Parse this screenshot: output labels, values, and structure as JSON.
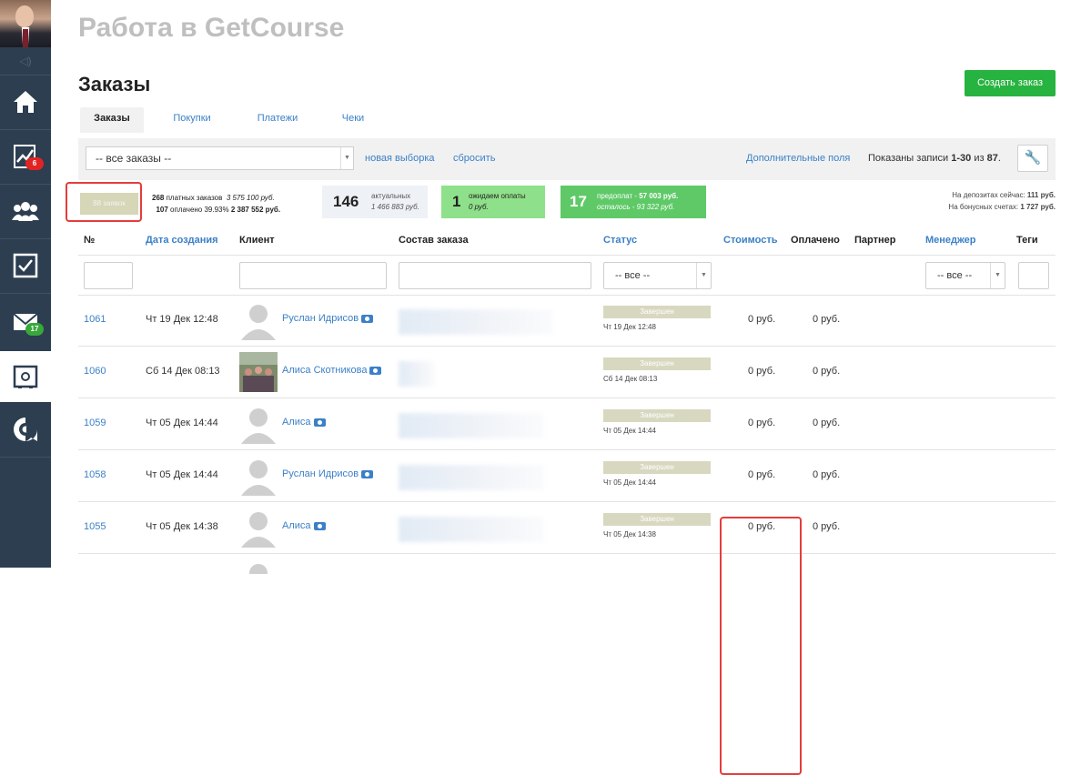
{
  "sidebar": {
    "avatar_label": "user-avatar",
    "badges": {
      "stats": "6",
      "mail": "17"
    }
  },
  "header": {
    "school_title": "Работа в GetCourse",
    "page_title": "Заказы",
    "create_button": "Создать заказ"
  },
  "tabs": [
    {
      "label": "Заказы"
    },
    {
      "label": "Покупки"
    },
    {
      "label": "Платежи"
    },
    {
      "label": "Чеки"
    }
  ],
  "filter": {
    "selection": "-- все заказы --",
    "new_selection": "новая выборка",
    "reset": "сбросить",
    "extra_fields": "Дополнительные поля",
    "shown_prefix": "Показаны записи ",
    "shown_range": "1-30",
    "shown_mid": " из ",
    "shown_total": "87",
    "shown_suffix": "."
  },
  "stats": {
    "orders_count": "88 заявок",
    "paid_orders_count": "268",
    "paid_orders_label": "платных заказов",
    "paid_orders_sum": "3 575 100 руб.",
    "paid_count": "107",
    "paid_label": "оплачено 39.93%",
    "paid_sum": "2 387 552 руб.",
    "actual_count": "146",
    "actual_label": "актуальных",
    "actual_sum": "1 466 883 руб.",
    "waiting_count": "1",
    "waiting_label": "ожидаем оплаты",
    "waiting_sum": "0 руб.",
    "prepay_count": "17",
    "prepay_label": "предоплат - ",
    "prepay_sum": "57 003 руб.",
    "remaining_label": "осталось - 93 322 руб.",
    "deposit_label": "На депозитах сейчас: ",
    "deposit_value": "111 руб.",
    "bonus_label": "На бонусных счетах: ",
    "bonus_value": "1 727 руб."
  },
  "columns": {
    "num": "№",
    "created": "Дата создания",
    "client": "Клиент",
    "composition": "Состав заказа",
    "status": "Статус",
    "cost": "Стоимость",
    "paid": "Оплачено",
    "partner": "Партнер",
    "manager": "Менеджер",
    "tags": "Теги"
  },
  "filters": {
    "status_select": "-- все --",
    "manager_select": "-- все --"
  },
  "rows": [
    {
      "id": "1061",
      "date": "Чт 19 Дек 12:48",
      "client": "Руслан Идрисов",
      "status": "Завершен",
      "status_date": "Чт 19 Дек 12:48",
      "cost": "0 руб.",
      "paid": "0 руб."
    },
    {
      "id": "1060",
      "date": "Сб 14 Дек 08:13",
      "client": "Алиса Скотникова",
      "status": "Завершен",
      "status_date": "Сб 14 Дек 08:13",
      "cost": "0 руб.",
      "paid": "0 руб."
    },
    {
      "id": "1059",
      "date": "Чт 05 Дек 14:44",
      "client": "Алиса",
      "status": "Завершен",
      "status_date": "Чт 05 Дек 14:44",
      "cost": "0 руб.",
      "paid": "0 руб."
    },
    {
      "id": "1058",
      "date": "Чт 05 Дек 14:44",
      "client": "Руслан Идрисов",
      "status": "Завершен",
      "status_date": "Чт 05 Дек 14:44",
      "cost": "0 руб.",
      "paid": "0 руб."
    },
    {
      "id": "1055",
      "date": "Чт 05 Дек 14:38",
      "client": "Алиса",
      "status": "Завершен",
      "status_date": "Чт 05 Дек 14:38",
      "cost": "0 руб.",
      "paid": "0 руб."
    }
  ],
  "colors": {
    "sidebar": "#2c3e50",
    "link": "#3b80c7",
    "create_button": "#27b340",
    "highlight": "#e53c3c"
  }
}
